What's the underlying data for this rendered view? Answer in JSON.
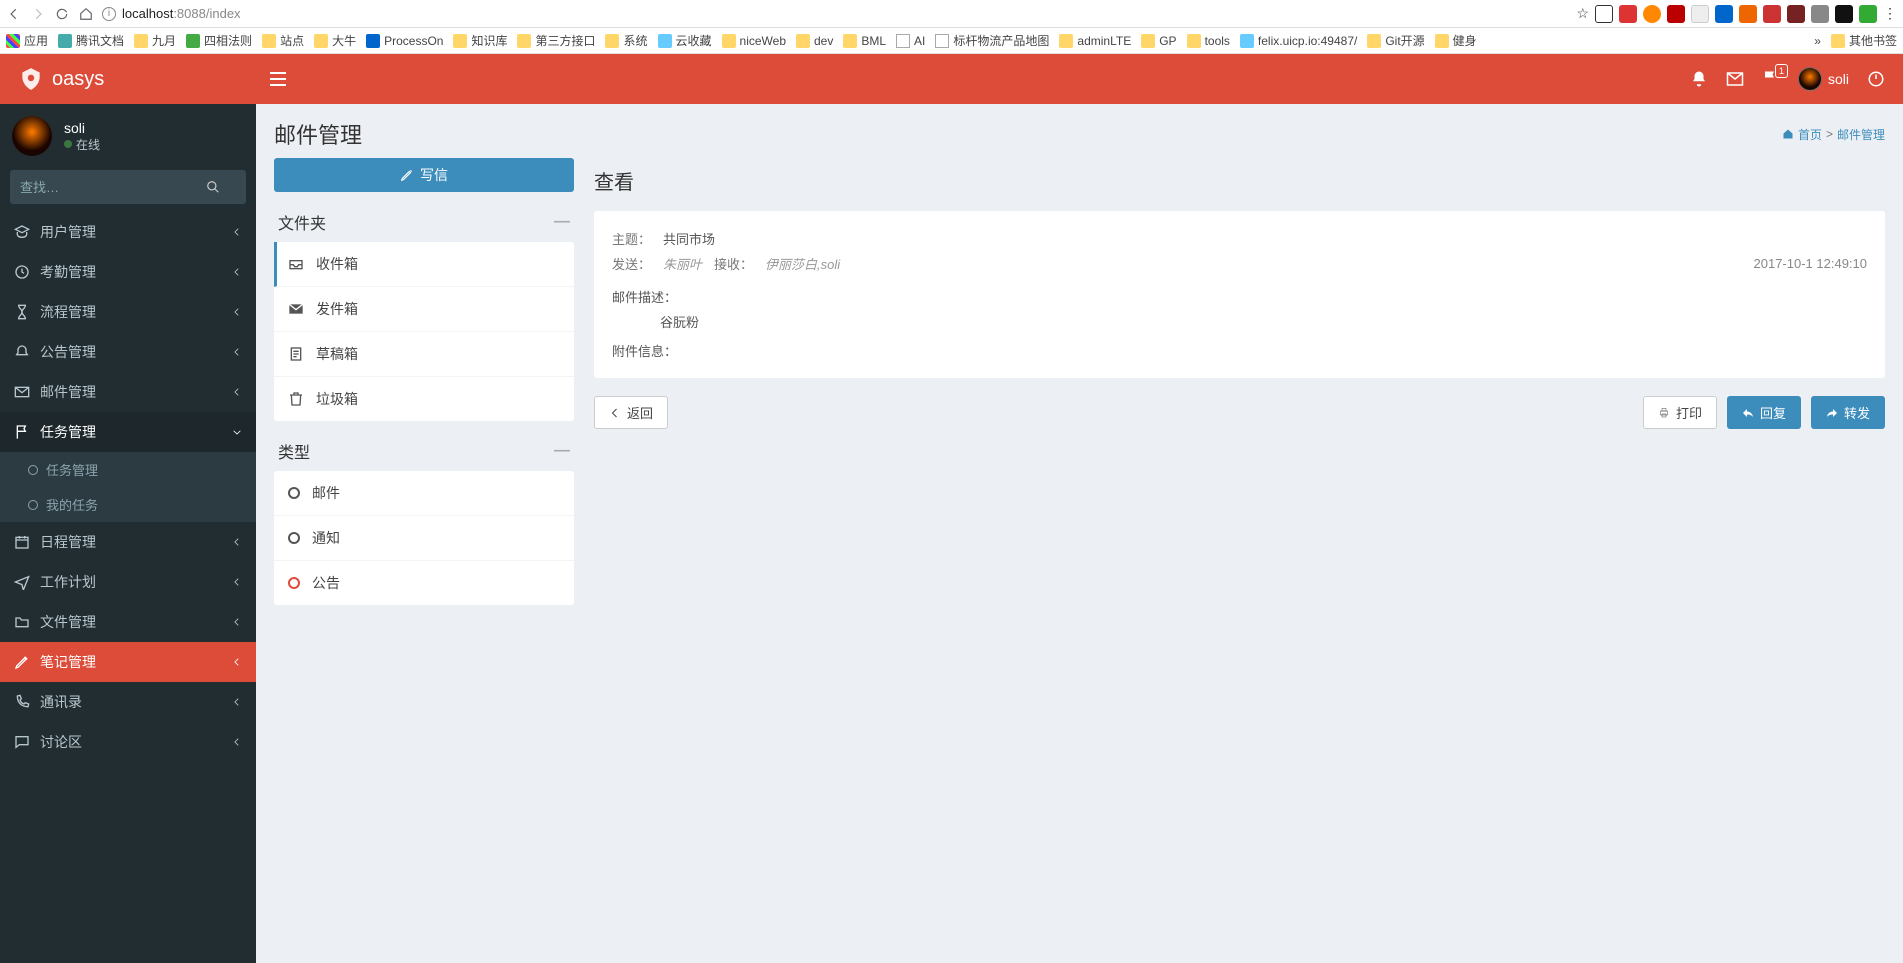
{
  "browser": {
    "url_host": "localhost",
    "url_port": ":8088",
    "url_path": "/index"
  },
  "bookmarks": {
    "apps": "应用",
    "items": [
      "腾讯文档",
      "九月",
      "四相法则",
      "站点",
      "大牛",
      "ProcessOn",
      "知识库",
      "第三方接口",
      "系统",
      "云收藏",
      "niceWeb",
      "dev",
      "BML",
      "AI",
      "标杆物流产品地图",
      "adminLTE",
      "GP",
      "tools",
      "felix.uicp.io:49487/",
      "Git开源",
      "健身"
    ],
    "other": "其他书签"
  },
  "header": {
    "brand": "oasys",
    "user": "soli",
    "flag_badge": "1"
  },
  "sidebar": {
    "user": {
      "name": "soli",
      "status": "在线"
    },
    "search_placeholder": "查找…",
    "menu": [
      {
        "icon": "grad",
        "label": "用户管理"
      },
      {
        "icon": "clock",
        "label": "考勤管理"
      },
      {
        "icon": "hourglass",
        "label": "流程管理"
      },
      {
        "icon": "bell",
        "label": "公告管理"
      },
      {
        "icon": "envelope",
        "label": "邮件管理"
      },
      {
        "icon": "flag",
        "label": "任务管理",
        "open": true,
        "children": [
          {
            "label": "任务管理"
          },
          {
            "label": "我的任务"
          }
        ]
      },
      {
        "icon": "calendar",
        "label": "日程管理"
      },
      {
        "icon": "plane",
        "label": "工作计划"
      },
      {
        "icon": "folder",
        "label": "文件管理"
      },
      {
        "icon": "edit",
        "label": "笔记管理",
        "active_red": true
      },
      {
        "icon": "phone",
        "label": "通讯录"
      },
      {
        "icon": "comment",
        "label": "讨论区"
      }
    ]
  },
  "page": {
    "title": "邮件管理",
    "breadcrumb_home": "首页",
    "breadcrumb_current": "邮件管理"
  },
  "compose": {
    "label": "写信"
  },
  "folders": {
    "title": "文件夹",
    "items": [
      {
        "icon": "inbox",
        "label": "收件箱",
        "active": true
      },
      {
        "icon": "envelope-bold",
        "label": "发件箱"
      },
      {
        "icon": "file",
        "label": "草稿箱"
      },
      {
        "icon": "trash",
        "label": "垃圾箱"
      }
    ]
  },
  "types": {
    "title": "类型",
    "items": [
      {
        "label": "邮件",
        "red": false
      },
      {
        "label": "通知",
        "red": false
      },
      {
        "label": "公告",
        "red": true
      }
    ]
  },
  "view": {
    "title": "查看",
    "subject_label": "主题：",
    "subject": "共同市场",
    "send_label": "发送：",
    "sender": "朱丽叶",
    "receive_label": "接收：",
    "receiver": "伊丽莎白,soli",
    "timestamp": "2017-10-1 12:49:10",
    "desc_label": "邮件描述：",
    "desc_body": "谷朊粉",
    "attach_label": "附件信息："
  },
  "actions": {
    "back": "返回",
    "print": "打印",
    "reply": "回复",
    "forward": "转发"
  }
}
